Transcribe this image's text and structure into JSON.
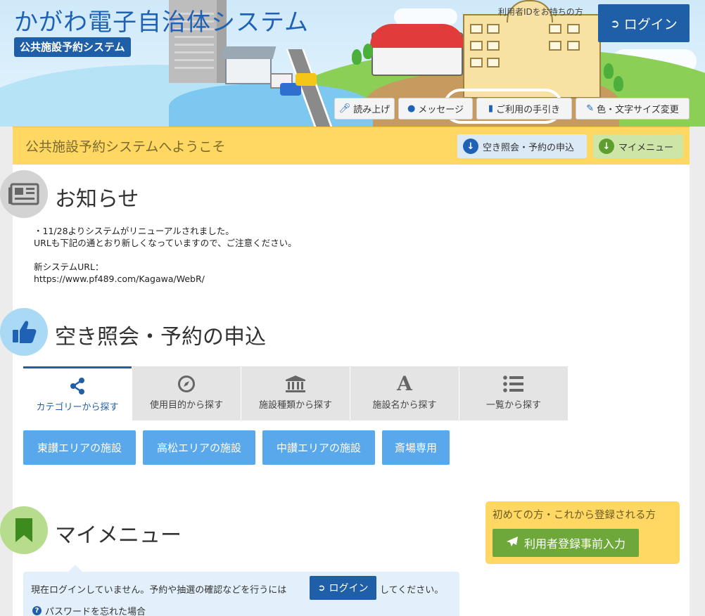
{
  "header": {
    "title": "かがわ電子自治体システム",
    "subtitle": "公共施設予約システム",
    "userid_note": "利用者IDをお持ちの方",
    "login_label": "ログイン",
    "tools": [
      {
        "label": "読み上げ",
        "icon": "microphone-icon"
      },
      {
        "label": "メッセージ",
        "icon": "comment-icon"
      },
      {
        "label": "ご利用の手引き",
        "icon": "book-icon"
      },
      {
        "label": "色・文字サイズ変更",
        "icon": "paintbrush-icon"
      }
    ]
  },
  "welcome": {
    "text": "公共施設予約システムへようこそ",
    "buttons": [
      {
        "label": "空き照会・予約の申込",
        "icon": "arrow-down-circle-icon",
        "color": "#1f62b5"
      },
      {
        "label": "マイメニュー",
        "icon": "arrow-down-circle-icon",
        "color": "#5e9e2f"
      }
    ]
  },
  "news": {
    "title": "お知らせ",
    "lines": [
      "・11/28よりシステムがリニューアルされました。",
      "URLも下記の通とおり新しくなっていますので、ご注意ください。",
      "",
      "新システムURL：",
      "https://www.pf489.com/Kagawa/WebR/"
    ]
  },
  "search": {
    "title": "空き照会・予約の申込",
    "tabs": [
      {
        "label": "カテゴリーから探す",
        "icon": "share-icon",
        "active": true
      },
      {
        "label": "使用目的から探す",
        "icon": "compass-icon",
        "active": false
      },
      {
        "label": "施設種類から探す",
        "icon": "institution-icon",
        "active": false
      },
      {
        "label": "施設名から探す",
        "icon": "font-a-icon",
        "active": false
      },
      {
        "label": "一覧から探す",
        "icon": "list-icon",
        "active": false
      }
    ],
    "areas": [
      "東讃エリアの施設",
      "高松エリアの施設",
      "中讃エリアの施設",
      "斎場専用"
    ]
  },
  "mymenu": {
    "title": "マイメニュー",
    "register_note": "初めての方・これから登録される方",
    "register_button": "利用者登録事前入力",
    "login_msg_before": "現在ログインしていません。予約や抽選の確認などを行うには",
    "login_button": "ログイン",
    "login_msg_after": "してください。",
    "forgot_password": "パスワードを忘れた場合"
  },
  "colors": {
    "brand_blue": "#1f5fa8",
    "area_button": "#5aa8ec",
    "welcome_bar": "#ffd863",
    "register_green": "#6fa83a"
  }
}
